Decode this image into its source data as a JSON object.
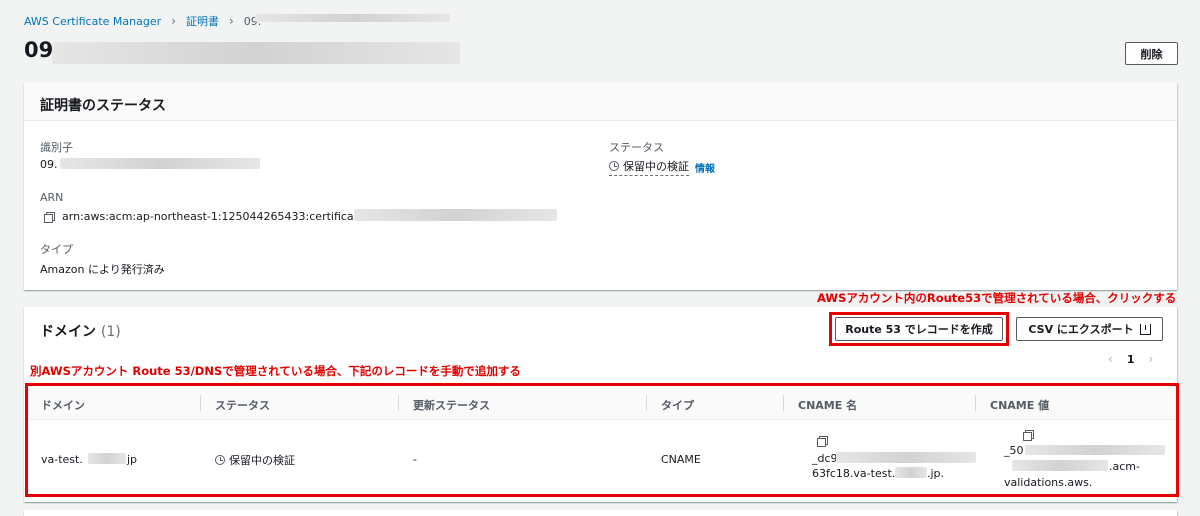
{
  "breadcrumb": {
    "service": "AWS Certificate Manager",
    "certificates": "証明書",
    "current": "09."
  },
  "page_title": "09",
  "delete_button": "削除",
  "status_panel": {
    "title": "証明書のステータス",
    "identifier_label": "識別子",
    "identifier_value": "09.",
    "arn_label": "ARN",
    "arn_value": "arn:aws:acm:ap-northeast-1:125044265433:certificate/09.",
    "type_label": "タイプ",
    "type_value": "Amazon により発行済み",
    "status_label": "ステータス",
    "status_value": "保留中の検証",
    "info_link": "情報"
  },
  "domain_panel": {
    "title": "ドメイン",
    "count": "(1)",
    "route53_button": "Route 53 でレコードを作成",
    "export_button": "CSV にエクスポート",
    "page_number": "1",
    "columns": [
      "ドメイン",
      "ステータス",
      "更新ステータス",
      "タイプ",
      "CNAME 名",
      "CNAME 値"
    ],
    "row": {
      "domain_a": "va-test.",
      "domain_b": "jp",
      "status": "保留中の検証",
      "renewal": "-",
      "type": "CNAME",
      "cname_name_1": "_dc9",
      "cname_name_2": "63fc18.va-test.",
      "cname_name_3": ".jp.",
      "cname_value_1": "_50",
      "cname_value_2": ".acm-",
      "cname_value_3": "validations.aws."
    }
  },
  "annotations": {
    "top": "AWSアカウント内のRoute53で管理されている場合、クリックする",
    "left": "別AWSアカウント Route 53/DNSで管理されている場合、下記のレコードを手動で追加する"
  },
  "colors": {
    "link": "#0073bb",
    "annotation": "#e30000",
    "background": "#f2f3f3"
  }
}
